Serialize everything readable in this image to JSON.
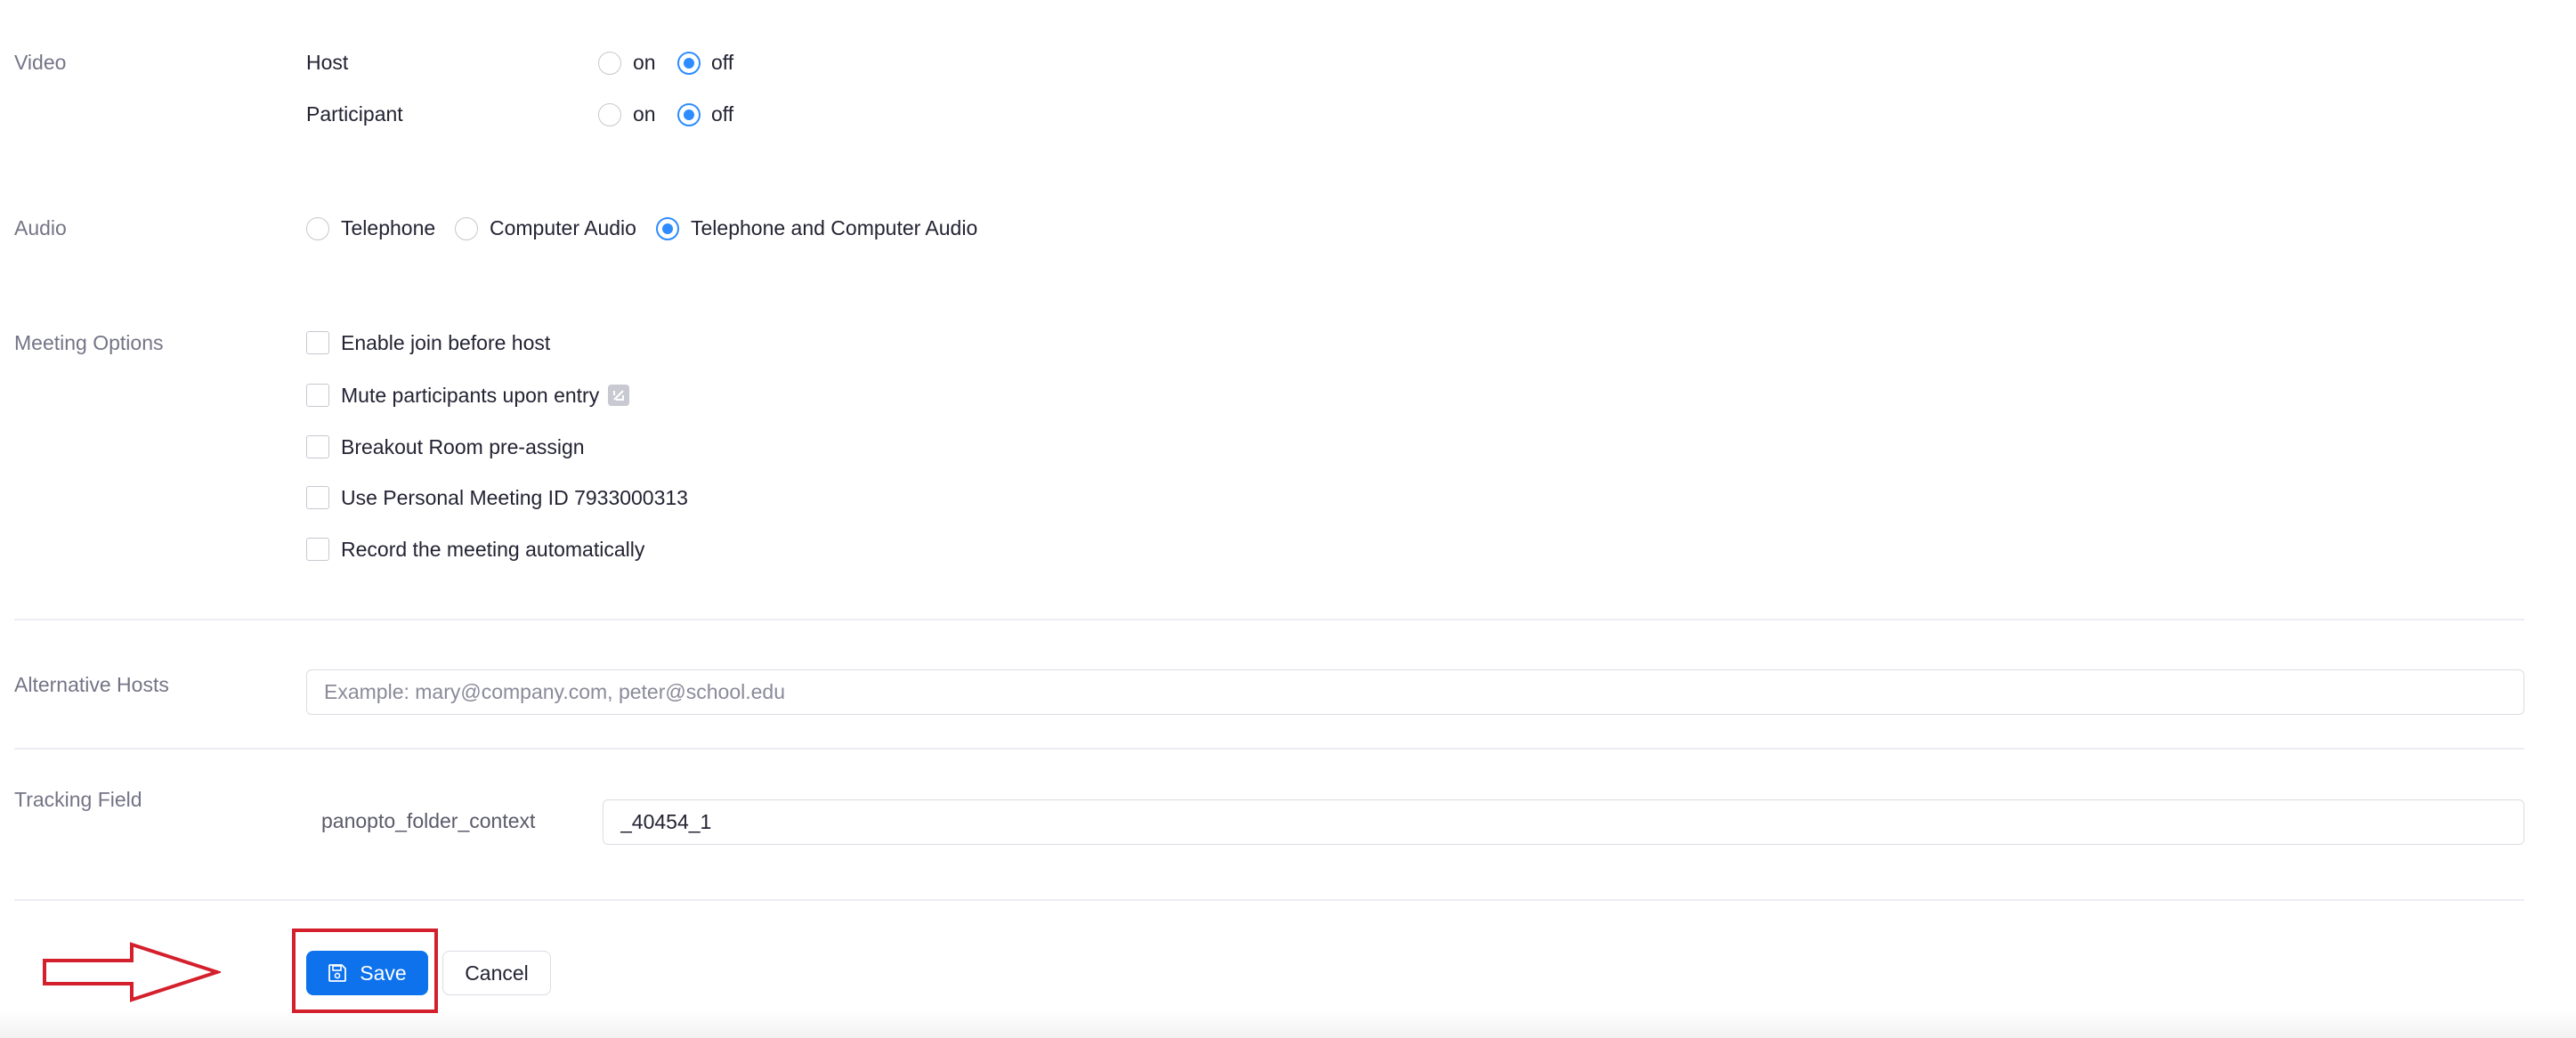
{
  "video": {
    "label": "Video",
    "host_label": "Host",
    "participant_label": "Participant",
    "on_label": "on",
    "off_label": "off",
    "host_value": "off",
    "participant_value": "off"
  },
  "audio": {
    "label": "Audio",
    "options": [
      "Telephone",
      "Computer Audio",
      "Telephone and Computer Audio"
    ],
    "selected": "Telephone and Computer Audio"
  },
  "meeting_options": {
    "label": "Meeting Options",
    "items": [
      {
        "label": "Enable join before host",
        "checked": false
      },
      {
        "label": "Mute participants upon entry",
        "checked": false,
        "info_icon": "info-icon"
      },
      {
        "label": "Breakout Room pre-assign",
        "checked": false
      },
      {
        "label": "Use Personal Meeting ID 7933000313",
        "checked": false
      },
      {
        "label": "Record the meeting automatically",
        "checked": false
      }
    ]
  },
  "alternative_hosts": {
    "label": "Alternative Hosts",
    "value": "",
    "placeholder": "Example: mary@company.com, peter@school.edu"
  },
  "tracking_field": {
    "label": "Tracking Field",
    "field_name": "panopto_folder_context",
    "value": "_40454_1"
  },
  "actions": {
    "save_label": "Save",
    "save_icon": "save-icon",
    "cancel_label": "Cancel"
  },
  "annotation": {
    "arrow_icon": "arrow-right-icon",
    "color": "#d4202c"
  },
  "colors": {
    "accent": "#0e72ed",
    "radio_selected": "#2d8cff",
    "annotation_red": "#d4202c"
  }
}
